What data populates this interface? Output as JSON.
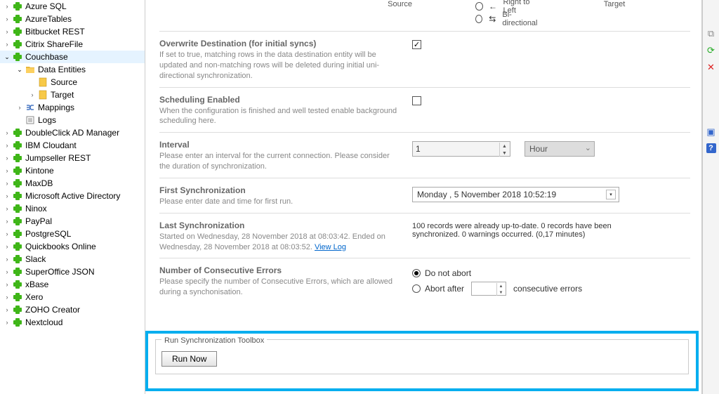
{
  "tree": {
    "items": [
      {
        "label": "Azure SQL",
        "icon": "puzzle",
        "depth": 1,
        "expander": "closed"
      },
      {
        "label": "AzureTables",
        "icon": "puzzle",
        "depth": 1,
        "expander": "closed"
      },
      {
        "label": "Bitbucket REST",
        "icon": "puzzle",
        "depth": 1,
        "expander": "closed"
      },
      {
        "label": "Citrix ShareFile",
        "icon": "puzzle",
        "depth": 1,
        "expander": "closed"
      },
      {
        "label": "Couchbase",
        "icon": "puzzle",
        "depth": 1,
        "expander": "open",
        "selected": true
      },
      {
        "label": "Data Entities",
        "icon": "folder",
        "depth": 2,
        "expander": "open"
      },
      {
        "label": "Source",
        "icon": "doc",
        "depth": 3,
        "expander": "none"
      },
      {
        "label": "Target",
        "icon": "doc",
        "depth": 3,
        "expander": "closed"
      },
      {
        "label": "Mappings",
        "icon": "map",
        "depth": 2,
        "expander": "closed"
      },
      {
        "label": "Logs",
        "icon": "log",
        "depth": 2,
        "expander": "none"
      },
      {
        "label": "DoubleClick  AD Manager",
        "icon": "puzzle",
        "depth": 1,
        "expander": "closed"
      },
      {
        "label": "IBM Cloudant",
        "icon": "puzzle",
        "depth": 1,
        "expander": "closed"
      },
      {
        "label": "Jumpseller REST",
        "icon": "puzzle",
        "depth": 1,
        "expander": "closed"
      },
      {
        "label": "Kintone",
        "icon": "puzzle",
        "depth": 1,
        "expander": "closed"
      },
      {
        "label": "MaxDB",
        "icon": "puzzle",
        "depth": 1,
        "expander": "closed"
      },
      {
        "label": "Microsoft Active Directory",
        "icon": "puzzle",
        "depth": 1,
        "expander": "closed"
      },
      {
        "label": "Ninox",
        "icon": "puzzle",
        "depth": 1,
        "expander": "closed"
      },
      {
        "label": "PayPal",
        "icon": "puzzle",
        "depth": 1,
        "expander": "closed"
      },
      {
        "label": "PostgreSQL",
        "icon": "puzzle",
        "depth": 1,
        "expander": "closed"
      },
      {
        "label": "Quickbooks Online",
        "icon": "puzzle",
        "depth": 1,
        "expander": "closed"
      },
      {
        "label": "Slack",
        "icon": "puzzle",
        "depth": 1,
        "expander": "closed"
      },
      {
        "label": "SuperOffice JSON",
        "icon": "puzzle",
        "depth": 1,
        "expander": "closed"
      },
      {
        "label": "xBase",
        "icon": "puzzle",
        "depth": 1,
        "expander": "closed"
      },
      {
        "label": "Xero",
        "icon": "puzzle",
        "depth": 1,
        "expander": "closed"
      },
      {
        "label": "ZOHO Creator",
        "icon": "puzzle",
        "depth": 1,
        "expander": "closed"
      },
      {
        "label": "Nextcloud",
        "icon": "puzzle",
        "depth": 1,
        "expander": "closed"
      }
    ]
  },
  "header": {
    "source_label": "Source",
    "target_label": "Target",
    "dir_rtl": "Right to Left",
    "dir_bi": "Bi-directional"
  },
  "overwrite": {
    "title": "Overwrite Destination (for initial syncs)",
    "desc": "If set to true, matching rows in the data destination entity will be updated and non-matching rows will be deleted during initial uni-directional synchronization.",
    "checked": true
  },
  "scheduling": {
    "title": "Scheduling Enabled",
    "desc": "When the configuration is finished and well tested enable background scheduling here.",
    "checked": false
  },
  "interval": {
    "title": "Interval",
    "desc": "Please enter an interval for the current connection. Please consider the duration of synchronization.",
    "value": "1",
    "unit": "Hour"
  },
  "first_sync": {
    "title": "First Synchronization",
    "desc": "Please enter date and time for first run.",
    "value": "Monday  ,   5 November 2018 10:52:19"
  },
  "last_sync": {
    "title": "Last Synchronization",
    "desc": "Started  on Wednesday, 28 November 2018 at 08:03:42. Ended on Wednesday, 28 November 2018 at 08:03:52. ",
    "link": "View Log",
    "result": "100 records were already up-to-date. 0 records have been synchronized. 0 warnings occurred. (0,17 minutes)"
  },
  "errors": {
    "title": "Number of Consecutive Errors",
    "desc": "Please specify the number of Consecutive Errors, which are allowed during a synchonisation.",
    "opt_noabort": "Do not abort",
    "opt_abort_prefix": "Abort after",
    "opt_abort_suffix": "consecutive errors"
  },
  "runbox": {
    "legend": "Run Synchronization Toolbox",
    "button": "Run Now"
  }
}
